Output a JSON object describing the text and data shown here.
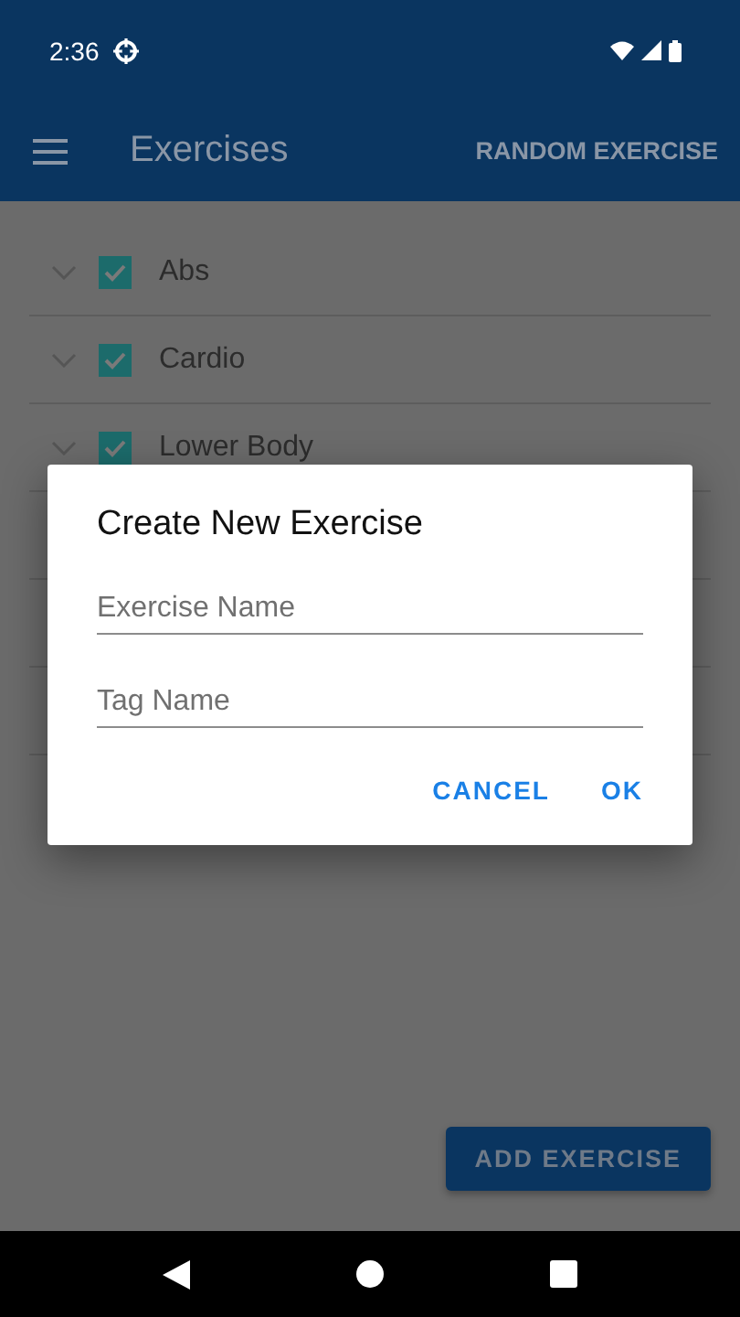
{
  "status_bar": {
    "time": "2:36"
  },
  "app_bar": {
    "title": "Exercises",
    "action": "RANDOM EXERCISE"
  },
  "categories": [
    {
      "name": "Abs",
      "checked": true
    },
    {
      "name": "Cardio",
      "checked": true
    },
    {
      "name": "Lower Body",
      "checked": true
    }
  ],
  "dialog": {
    "title": "Create New Exercise",
    "fields": [
      {
        "placeholder": "Exercise Name"
      },
      {
        "placeholder": "Tag Name"
      }
    ],
    "buttons": [
      "CANCEL",
      "OK"
    ]
  },
  "add_button": "ADD EXERCISE"
}
